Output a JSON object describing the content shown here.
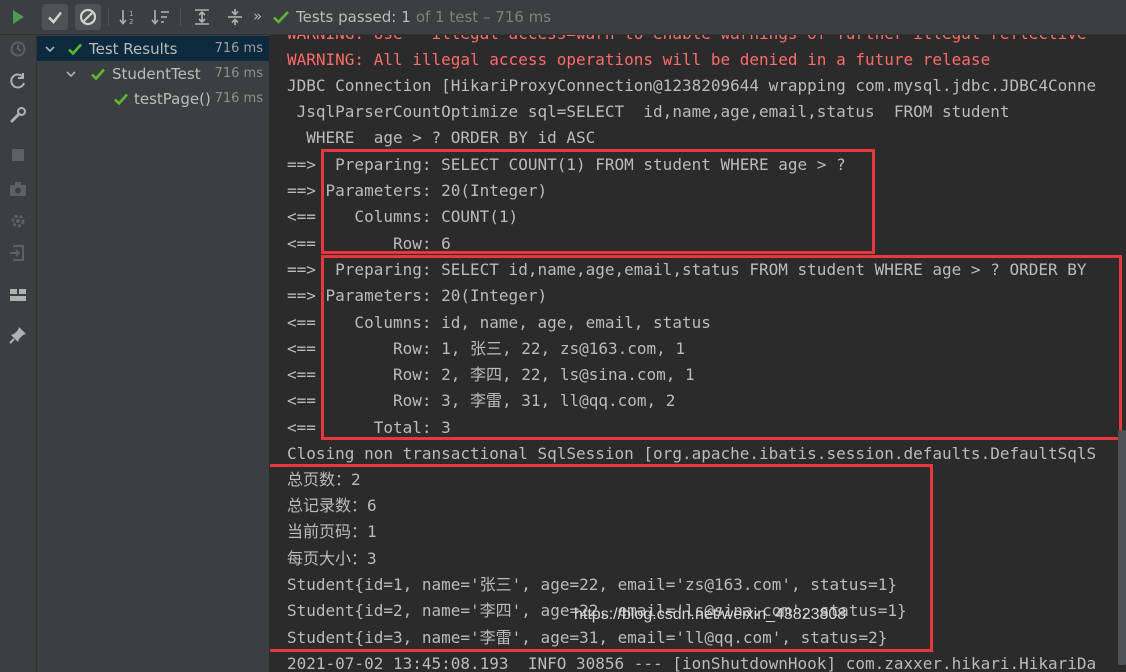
{
  "toolbar": {
    "status_passed": "Tests passed:",
    "status_count": "1",
    "status_rest": "of 1 test – 716 ms",
    "more": "»"
  },
  "colors": {
    "pass": "#5fb832",
    "run": "#499c54",
    "warn": "#ff6b68",
    "highlight_box": "#e8383d",
    "selection": "#0d293e"
  },
  "tree": {
    "items": [
      {
        "label": "Test Results",
        "time": "716 ms"
      },
      {
        "label": "StudentTest",
        "time": "716 ms"
      },
      {
        "label": "testPage()",
        "time": "716 ms"
      }
    ]
  },
  "console": {
    "lines": [
      "WARNING: Use --illegal-access=warn to enable warnings of further illegal reflective",
      "WARNING: All illegal access operations will be denied in a future release",
      "JDBC Connection [HikariProxyConnection@1238209644 wrapping com.mysql.jdbc.JDBC4Conne",
      " JsqlParserCountOptimize sql=SELECT  id,name,age,email,status  FROM student",
      "  WHERE  age > ? ORDER BY id ASC",
      "==>  Preparing: SELECT COUNT(1) FROM student WHERE age > ?",
      "==> Parameters: 20(Integer)",
      "<==    Columns: COUNT(1)",
      "<==        Row: 6",
      "==>  Preparing: SELECT id,name,age,email,status FROM student WHERE age > ? ORDER BY",
      "==> Parameters: 20(Integer)",
      "<==    Columns: id, name, age, email, status",
      "<==        Row: 1, 张三, 22, zs@163.com, 1",
      "<==        Row: 2, 李四, 22, ls@sina.com, 1",
      "<==        Row: 3, 李雷, 31, ll@qq.com, 2",
      "<==      Total: 3",
      "Closing non transactional SqlSession [org.apache.ibatis.session.defaults.DefaultSqlS",
      "总页数：2",
      "总记录数：6",
      "当前页码：1",
      "每页大小：3",
      "Student{id=1, name='张三', age=22, email='zs@163.com', status=1}",
      "Student{id=2, name='李四', age=22, email='ls@sina.com', status=1}",
      "Student{id=3, name='李雷', age=31, email='ll@qq.com', status=2}",
      "2021-07-02 13:45:08.193  INFO 30856 --- [ionShutdownHook] com.zaxxer.hikari.HikariDa"
    ]
  },
  "watermark": "https://blog.csdn.net/weixin_43823808"
}
